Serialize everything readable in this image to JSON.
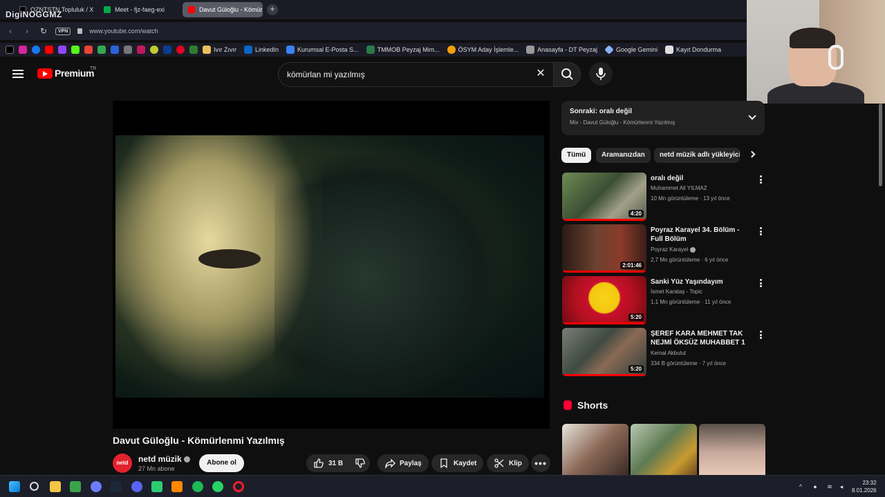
{
  "browser": {
    "brand_overlay": "DigiNOGGMZ",
    "tabs": [
      {
        "label": "OZNTSTN Topluluk / X",
        "color": "#000000"
      },
      {
        "label": "Meet - fjz-faeg-exi",
        "color": "#00ac47"
      },
      {
        "label": "Davut Güloğlu - Kömürlenmi",
        "color": "#ff0000",
        "active": true
      }
    ],
    "new_tab": "+",
    "vpn": "VPN",
    "url": "www.youtube.com/watch",
    "bookmarks": [
      {
        "label": "Ivır Zıvır",
        "icon": "folder-icon",
        "color": "#e8c25a"
      },
      {
        "label": "LinkedIn",
        "icon": "linkedin-icon",
        "color": "#0a66c2"
      },
      {
        "label": "Kurumsal E-Posta S...",
        "icon": "mail-icon",
        "color": "#3b82f6"
      },
      {
        "label": "TMMOB Peyzaj Mim...",
        "icon": "phone-icon",
        "color": "#2b7a4b"
      },
      {
        "label": "ÖSYM Aday İşlemle...",
        "icon": "osym-icon",
        "color": "#f59e0b"
      },
      {
        "label": "Anasayfa - DT Peyzaj",
        "icon": "doc-icon",
        "color": "#999999"
      },
      {
        "label": "Google Gemini",
        "icon": "gemini-icon",
        "color": "#8ab4f8"
      },
      {
        "label": "Kayıt Dondurma",
        "icon": "page-icon",
        "color": "#e0e0e0"
      }
    ]
  },
  "youtube": {
    "logo_text": "Premium",
    "region": "TR",
    "search_query": "kömürlan mi yazılmış",
    "video": {
      "title": "Davut Güloğlu - Kömürlenmi Yazılmış",
      "channel": "netd müzik",
      "avatar_text": "netd",
      "subscribers": "27 Mn abone",
      "subscribe_label": "Abone ol",
      "likes": "31 B",
      "share_label": "Paylaş",
      "save_label": "Kaydet",
      "clip_label": "Klip"
    },
    "up_next": {
      "title": "Sonraki: oralı değil",
      "subtitle": "Mix - Davut Güloğlu - Kömürlenmi Yazılmış"
    },
    "chips": [
      "Tümü",
      "Aramanızdan",
      "netd müzik adlı yükleyici"
    ],
    "recommendations": [
      {
        "title": "oralı değil",
        "channel": "Muhammet Ali YILMAZ",
        "meta": "10 Mn görüntüleme · 13 yıl önce",
        "duration": "4:20",
        "verified": false,
        "progress": 1.0
      },
      {
        "title": "Poyraz Karayel 34. Bölüm - Full Bölüm",
        "channel": "Poyraz Karayel",
        "meta": "2,7 Mn görüntüleme · 6 yıl önce",
        "duration": "2:01:46",
        "verified": true,
        "progress": 1.0
      },
      {
        "title": "Sanki Yüz Yaşındayım",
        "channel": "İsmet Karataş - Topic",
        "meta": "1,1 Mn görüntüleme · 11 yıl önce",
        "duration": "5:20",
        "verified": false,
        "progress": 1.0
      },
      {
        "title": "ŞEREF KARA MEHMET TAK NEJMİ ÖKSÜZ MUHABBET  1",
        "channel": "Kemal Akbulut",
        "meta": "334 B görüntüleme · 7 yıl önce",
        "duration": "5:20",
        "verified": false,
        "progress": 1.0
      }
    ],
    "shorts_label": "Shorts"
  },
  "taskbar": {
    "time": "23:32",
    "date": "8.01.2026"
  }
}
